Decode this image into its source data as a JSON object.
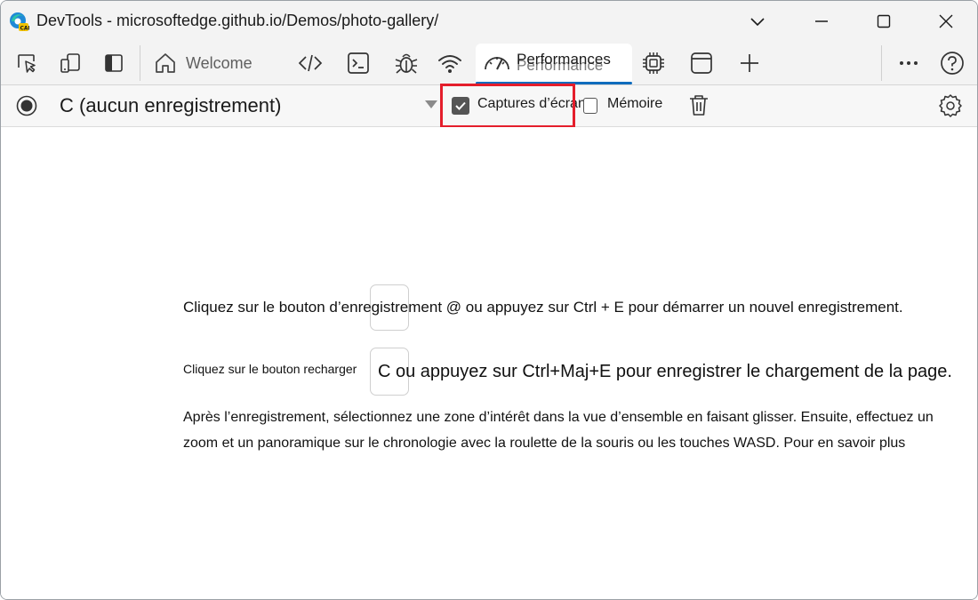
{
  "window": {
    "title": "DevTools - microsoftedge.github.io/Demos/photo-gallery/"
  },
  "tabs": {
    "welcome_label": "Welcome",
    "performance_label": "Performances",
    "performance_ghost_label": "Performance"
  },
  "toolbar": {
    "profile_value": "C (aucun enregistrement)",
    "screenshots_label": "Captures d’écran",
    "screenshots_checked": true,
    "memory_label": "Mémoire",
    "memory_checked": false
  },
  "content": {
    "line1": "Cliquez sur le bouton d’enregistrement @ ou appuyez sur Ctrl + E pour démarrer un nouvel enregistrement.",
    "line2_prefix": "Cliquez sur le bouton recharger",
    "line2_suffix": "C ou appuyez sur Ctrl+Maj+E pour enregistrer le chargement de la page.",
    "paragraph": "Après l’enregistrement, sélectionnez une zone d’intérêt dans la vue d’ensemble en faisant glisser. Ensuite, effectuez un zoom et un panoramique sur le chronologie avec la roulette de la souris ou les touches WASD. Pour en savoir plus"
  },
  "colors": {
    "accent": "#0f6cbd",
    "highlight": "#e41e2b"
  },
  "icons": {
    "title": "edge-canary-logo-icon",
    "tabbar": [
      "inspect-icon",
      "device-emulation-icon",
      "dock-side-icon",
      "home-icon",
      "elements-icon",
      "console-icon",
      "sources-bug-icon",
      "network-wifi-icon",
      "performance-gauge-icon",
      "memory-chip-icon",
      "application-window-icon",
      "add-tool-icon",
      "more-icon",
      "help-icon"
    ],
    "toolbar": [
      "record-icon",
      "dropdown-arrow-icon",
      "trash-icon",
      "settings-gear-icon"
    ]
  }
}
